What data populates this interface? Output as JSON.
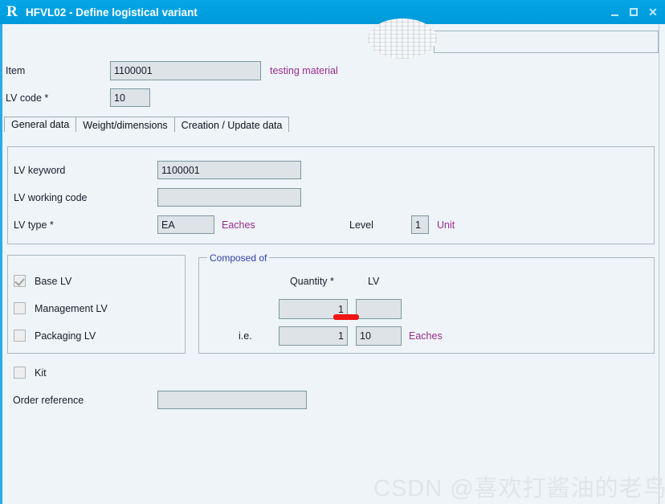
{
  "window": {
    "logo": "R",
    "title": "HFVL02 - Define logistical variant",
    "controls": {
      "minimize": "minimize-icon",
      "maximize": "maximize-icon",
      "close": "close-icon"
    }
  },
  "toolbar": {
    "search_value": "",
    "search_placeholder": ""
  },
  "header": {
    "item_label": "Item",
    "item_value": "1100001",
    "item_description": "testing material",
    "lv_code_label": "LV code *",
    "lv_code_value": "10"
  },
  "tabs": [
    {
      "label": "General data",
      "active": true
    },
    {
      "label": "Weight/dimensions",
      "active": false
    },
    {
      "label": "Creation / Update data",
      "active": false
    }
  ],
  "general_panel": {
    "lv_keyword_label": "LV keyword",
    "lv_keyword_value": "1100001",
    "lv_working_code_label": "LV working code",
    "lv_working_code_value": "",
    "lv_type_label": "LV type *",
    "lv_type_value": "EA",
    "lv_type_description": "Eaches",
    "level_label": "Level",
    "level_value": "1",
    "level_unit": "Unit"
  },
  "lv_kind_panel": {
    "options": [
      {
        "label": "Base LV",
        "checked": true
      },
      {
        "label": "Management LV",
        "checked": false
      },
      {
        "label": "Packaging LV",
        "checked": false
      }
    ]
  },
  "kit": {
    "label": "Kit",
    "checked": false
  },
  "order_reference": {
    "label": "Order reference",
    "value": ""
  },
  "composed_of": {
    "legend": "Composed of",
    "quantity_header": "Quantity *",
    "lv_header": "LV",
    "quantity_value": "1",
    "lv_value": "",
    "ie_label": "i.e.",
    "ie_quantity_value": "1",
    "ie_lv_value": "10",
    "ie_unit": "Eaches"
  },
  "annotation": {
    "red_underline": "red-underline-mark"
  },
  "watermark": {
    "text": "CSDN @喜欢打酱油的老鸟"
  },
  "colors": {
    "titlebar": "#00a0e0",
    "background": "#eef4f7",
    "field_fill": "#dde3e6",
    "field_border": "#7d97a5",
    "magenta_text": "#9b2d8f",
    "legend_blue": "#2f3faa",
    "annotation_red": "#f01414",
    "rail_blue": "#29abe8"
  }
}
